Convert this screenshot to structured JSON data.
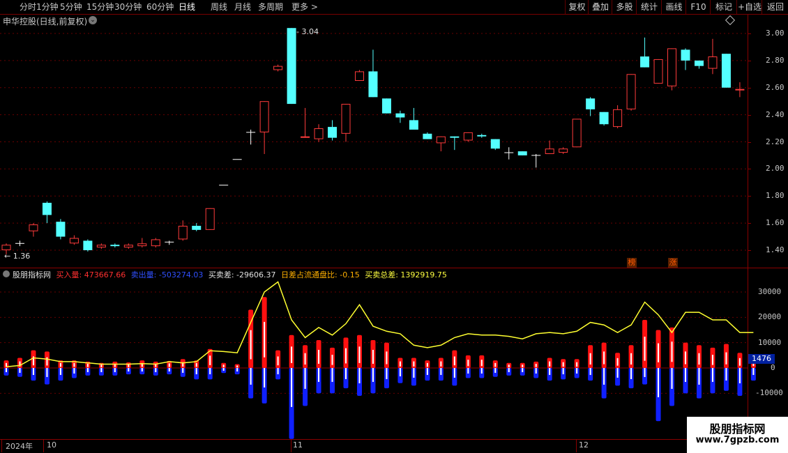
{
  "toolbar": {
    "left_tabs": [
      "分时",
      "1分钟",
      "5分钟",
      "15分钟",
      "30分钟",
      "60分钟",
      "日线",
      "周线",
      "月线",
      "多周期",
      "更多 >"
    ],
    "active_tab": "日线",
    "right_buttons": [
      "复权",
      "叠加",
      "多股",
      "统计",
      "画线",
      "F10",
      "标记",
      "+自选",
      "返回"
    ]
  },
  "main_chart": {
    "title": "申华控股(日线,前复权)",
    "high_label": "3.04",
    "low_label": "1.36",
    "price_axis": [
      "3.00",
      "2.80",
      "2.60",
      "2.40",
      "2.20",
      "2.00",
      "1.80",
      "1.60",
      "1.40"
    ],
    "badges": [
      "榜",
      "涨"
    ]
  },
  "indicator": {
    "name": "股朋指标网",
    "items": [
      {
        "label": "买入量: 473667.66",
        "color": "#ff3030"
      },
      {
        "label": "卖出量: -503274.03",
        "color": "#3050ff"
      },
      {
        "label": "买卖差: -29606.37",
        "color": "#e0e0e0"
      },
      {
        "label": "日差占流通盘比: -0.15",
        "color": "#ffb000"
      },
      {
        "label": "买卖总差: 1392919.75",
        "color": "#ffff40"
      }
    ],
    "axis": [
      "30000",
      "20000",
      "10000",
      "0",
      "-10000"
    ],
    "last_value": "1476"
  },
  "date_axis": {
    "labels": [
      "2024年",
      "10",
      "11",
      "12"
    ]
  },
  "watermark": {
    "line1": "股朋指标网",
    "line2": "www.7gpzb.com"
  },
  "colors": {
    "up": "#ff3b3b",
    "down": "#54ffff",
    "flat": "#ffffff",
    "buy": "#ff1010",
    "sell": "#1020ff",
    "line": "#ffff30"
  },
  "chart_data": [
    {
      "type": "candlestick",
      "title": "申华控股(日线,前复权)",
      "ylim": [
        1.3,
        3.1
      ],
      "candles": [
        {
          "o": 1.4,
          "c": 1.44,
          "h": 1.45,
          "l": 1.37
        },
        {
          "o": 1.45,
          "c": 1.45,
          "h": 1.47,
          "l": 1.43
        },
        {
          "o": 1.54,
          "c": 1.59,
          "h": 1.6,
          "l": 1.5
        },
        {
          "o": 1.75,
          "c": 1.66,
          "h": 1.76,
          "l": 1.6
        },
        {
          "o": 1.61,
          "c": 1.5,
          "h": 1.63,
          "l": 1.48
        },
        {
          "o": 1.45,
          "c": 1.49,
          "h": 1.51,
          "l": 1.44
        },
        {
          "o": 1.47,
          "c": 1.4,
          "h": 1.48,
          "l": 1.39
        },
        {
          "o": 1.42,
          "c": 1.44,
          "h": 1.45,
          "l": 1.41
        },
        {
          "o": 1.44,
          "c": 1.43,
          "h": 1.45,
          "l": 1.42
        },
        {
          "o": 1.42,
          "c": 1.44,
          "h": 1.45,
          "l": 1.41
        },
        {
          "o": 1.43,
          "c": 1.45,
          "h": 1.49,
          "l": 1.42
        },
        {
          "o": 1.43,
          "c": 1.48,
          "h": 1.49,
          "l": 1.42
        },
        {
          "o": 1.46,
          "c": 1.46,
          "h": 1.47,
          "l": 1.44
        },
        {
          "o": 1.48,
          "c": 1.58,
          "h": 1.62,
          "l": 1.47
        },
        {
          "o": 1.58,
          "c": 1.55,
          "h": 1.6,
          "l": 1.54
        },
        {
          "o": 1.55,
          "c": 1.71,
          "h": 1.71,
          "l": 1.55
        },
        {
          "o": 1.88,
          "c": 1.88,
          "h": 1.88,
          "l": 1.88
        },
        {
          "o": 2.07,
          "c": 2.07,
          "h": 2.07,
          "l": 2.07
        },
        {
          "o": 2.27,
          "c": 2.27,
          "h": 2.29,
          "l": 2.18
        },
        {
          "o": 2.27,
          "c": 2.5,
          "h": 2.5,
          "l": 2.11
        },
        {
          "o": 2.73,
          "c": 2.76,
          "h": 2.77,
          "l": 2.72
        },
        {
          "o": 3.04,
          "c": 2.48,
          "h": 3.04,
          "l": 2.48
        },
        {
          "o": 2.23,
          "c": 2.24,
          "h": 2.45,
          "l": 2.23
        },
        {
          "o": 2.22,
          "c": 2.3,
          "h": 2.33,
          "l": 2.2
        },
        {
          "o": 2.31,
          "c": 2.23,
          "h": 2.36,
          "l": 2.21
        },
        {
          "o": 2.26,
          "c": 2.48,
          "h": 2.48,
          "l": 2.2
        },
        {
          "o": 2.65,
          "c": 2.72,
          "h": 2.73,
          "l": 2.65
        },
        {
          "o": 2.72,
          "c": 2.53,
          "h": 2.88,
          "l": 2.53
        },
        {
          "o": 2.52,
          "c": 2.41,
          "h": 2.52,
          "l": 2.41
        },
        {
          "o": 2.41,
          "c": 2.38,
          "h": 2.43,
          "l": 2.34
        },
        {
          "o": 2.36,
          "c": 2.29,
          "h": 2.45,
          "l": 2.29
        },
        {
          "o": 2.26,
          "c": 2.22,
          "h": 2.27,
          "l": 2.22
        },
        {
          "o": 2.19,
          "c": 2.24,
          "h": 2.24,
          "l": 2.13
        },
        {
          "o": 2.24,
          "c": 2.23,
          "h": 2.24,
          "l": 2.14
        },
        {
          "o": 2.21,
          "c": 2.27,
          "h": 2.27,
          "l": 2.2
        },
        {
          "o": 2.25,
          "c": 2.24,
          "h": 2.26,
          "l": 2.23
        },
        {
          "o": 2.22,
          "c": 2.15,
          "h": 2.22,
          "l": 2.14
        },
        {
          "o": 2.12,
          "c": 2.12,
          "h": 2.16,
          "l": 2.07
        },
        {
          "o": 2.13,
          "c": 2.1,
          "h": 2.13,
          "l": 2.1
        },
        {
          "o": 2.1,
          "c": 2.1,
          "h": 2.11,
          "l": 2.01
        },
        {
          "o": 2.11,
          "c": 2.15,
          "h": 2.21,
          "l": 2.11
        },
        {
          "o": 2.12,
          "c": 2.15,
          "h": 2.16,
          "l": 2.11
        },
        {
          "o": 2.16,
          "c": 2.37,
          "h": 2.37,
          "l": 2.16
        },
        {
          "o": 2.52,
          "c": 2.44,
          "h": 2.53,
          "l": 2.39
        },
        {
          "o": 2.42,
          "c": 2.33,
          "h": 2.42,
          "l": 2.32
        },
        {
          "o": 2.31,
          "c": 2.44,
          "h": 2.47,
          "l": 2.3
        },
        {
          "o": 2.44,
          "c": 2.7,
          "h": 2.7,
          "l": 2.43
        },
        {
          "o": 2.83,
          "c": 2.75,
          "h": 2.97,
          "l": 2.75
        },
        {
          "o": 2.63,
          "c": 2.81,
          "h": 2.81,
          "l": 2.63
        },
        {
          "o": 2.61,
          "c": 2.89,
          "h": 2.89,
          "l": 2.58
        },
        {
          "o": 2.88,
          "c": 2.8,
          "h": 2.89,
          "l": 2.73
        },
        {
          "o": 2.8,
          "c": 2.76,
          "h": 2.8,
          "l": 2.74
        },
        {
          "o": 2.74,
          "c": 2.83,
          "h": 2.96,
          "l": 2.7
        },
        {
          "o": 2.85,
          "c": 2.6,
          "h": 2.85,
          "l": 2.6
        },
        {
          "o": 2.58,
          "c": 2.59,
          "h": 2.64,
          "l": 2.53
        }
      ]
    },
    {
      "type": "bar",
      "title": "股朋指标网",
      "ylim": [
        -22000,
        38000
      ],
      "buy": [
        3000,
        4000,
        7000,
        6500,
        3000,
        3000,
        2500,
        2000,
        2500,
        2200,
        3000,
        2500,
        2800,
        3500,
        3000,
        7500,
        2000,
        1500,
        23000,
        28000,
        7000,
        13000,
        9000,
        11000,
        8000,
        12000,
        13000,
        11000,
        10000,
        4000,
        4000,
        3000,
        4000,
        7000,
        5000,
        5000,
        3000,
        2000,
        2000,
        2500,
        4000,
        3500,
        3500,
        9000,
        10000,
        6000,
        9000,
        19000,
        15000,
        16000,
        10000,
        9000,
        8000,
        9500,
        6000,
        5000
      ],
      "sell": [
        -3000,
        -3500,
        -5000,
        -6500,
        -5000,
        -4000,
        -3000,
        -3000,
        -3000,
        -2500,
        -2500,
        -3000,
        -2500,
        -3500,
        -4500,
        -4500,
        -2000,
        -2500,
        -12000,
        -14000,
        -4500,
        -28000,
        -15000,
        -10000,
        -10000,
        -8000,
        -11000,
        -10000,
        -8000,
        -6000,
        -7000,
        -5000,
        -5000,
        -7000,
        -4000,
        -4000,
        -3500,
        -3000,
        -3000,
        -4000,
        -5000,
        -4500,
        -4000,
        -5000,
        -12000,
        -7000,
        -8000,
        -6500,
        -21000,
        -15000,
        -10000,
        -12000,
        -10000,
        -9000,
        -11000,
        -5000
      ],
      "total_line": [
        500,
        1000,
        4000,
        3500,
        2500,
        2500,
        2000,
        1500,
        1500,
        1500,
        1700,
        1500,
        2500,
        2000,
        2500,
        6800,
        6500,
        6000,
        18000,
        30000,
        34000,
        19000,
        12000,
        16000,
        13000,
        17500,
        25000,
        16500,
        14500,
        13500,
        9000,
        8000,
        9000,
        12000,
        13500,
        13000,
        13000,
        12500,
        11500,
        13500,
        14000,
        13500,
        14500,
        18000,
        17000,
        14000,
        17000,
        26000,
        21000,
        14000,
        22000,
        22000,
        19000,
        19000,
        14000,
        14000
      ]
    }
  ]
}
